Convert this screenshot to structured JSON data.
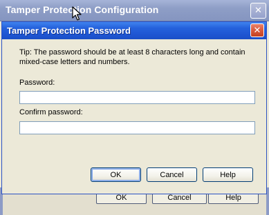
{
  "background_window": {
    "title": "Tamper Protection Configuration",
    "close_glyph": "✕",
    "buttons": {
      "ok": "OK",
      "cancel": "Cancel",
      "help": "Help"
    }
  },
  "dialog": {
    "title": "Tamper Protection Password",
    "close_glyph": "✕",
    "tip": "Tip: The password should be at least 8 characters long and contain mixed-case letters and numbers.",
    "password_label": "Password:",
    "password_value": "",
    "confirm_label": "Confirm password:",
    "confirm_value": "",
    "buttons": {
      "ok": "OK",
      "cancel": "Cancel",
      "help": "Help"
    }
  },
  "icons": [
    "close-icon",
    "mouse-cursor-icon"
  ],
  "colors": {
    "dialog_titlebar": "#2561dc",
    "close_button": "#d85a3c",
    "window_face": "#ece9d8"
  }
}
